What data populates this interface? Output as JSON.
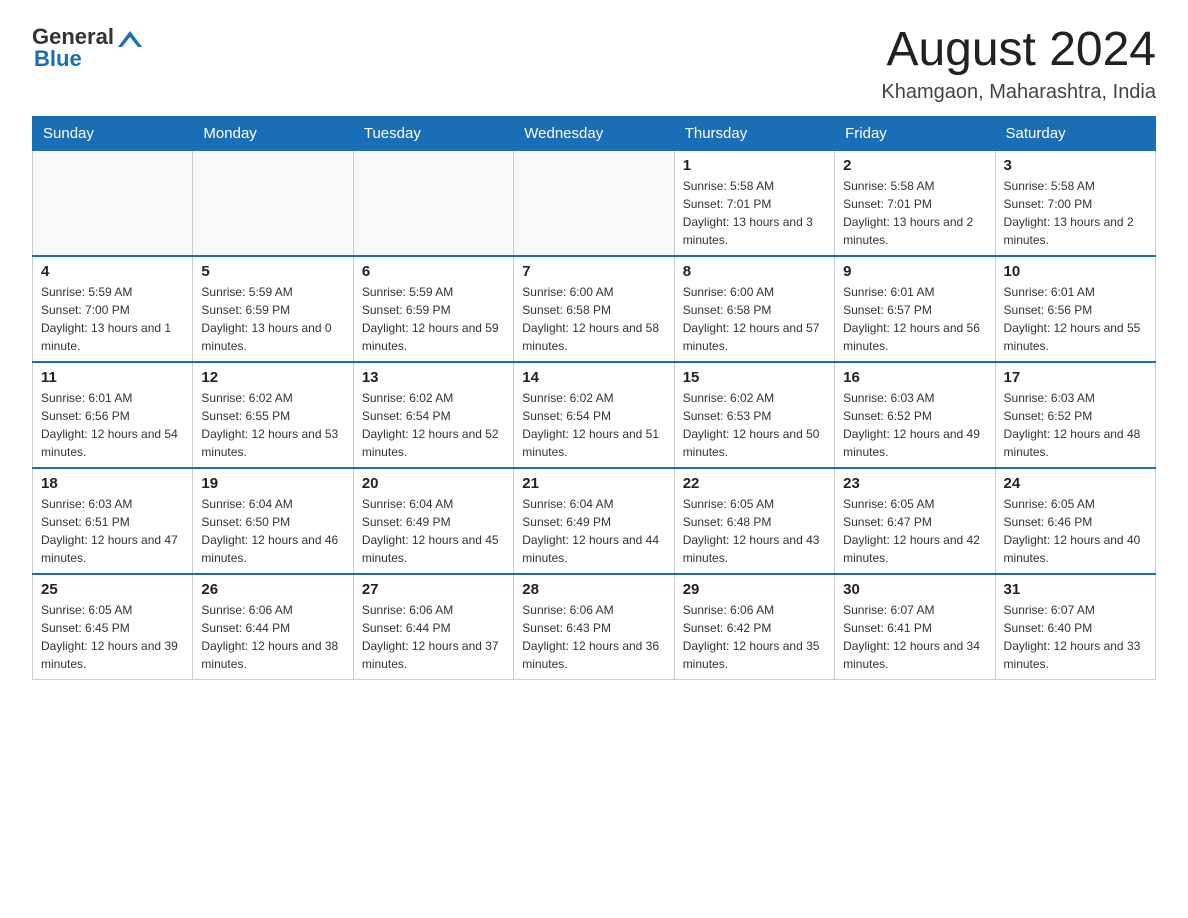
{
  "header": {
    "logo_general": "General",
    "logo_blue": "Blue",
    "month_title": "August 2024",
    "location": "Khamgaon, Maharashtra, India"
  },
  "weekdays": [
    "Sunday",
    "Monday",
    "Tuesday",
    "Wednesday",
    "Thursday",
    "Friday",
    "Saturday"
  ],
  "weeks": [
    [
      {
        "day": "",
        "sunrise": "",
        "sunset": "",
        "daylight": ""
      },
      {
        "day": "",
        "sunrise": "",
        "sunset": "",
        "daylight": ""
      },
      {
        "day": "",
        "sunrise": "",
        "sunset": "",
        "daylight": ""
      },
      {
        "day": "",
        "sunrise": "",
        "sunset": "",
        "daylight": ""
      },
      {
        "day": "1",
        "sunrise": "5:58 AM",
        "sunset": "7:01 PM",
        "daylight": "13 hours and 3 minutes."
      },
      {
        "day": "2",
        "sunrise": "5:58 AM",
        "sunset": "7:01 PM",
        "daylight": "13 hours and 2 minutes."
      },
      {
        "day": "3",
        "sunrise": "5:58 AM",
        "sunset": "7:00 PM",
        "daylight": "13 hours and 2 minutes."
      }
    ],
    [
      {
        "day": "4",
        "sunrise": "5:59 AM",
        "sunset": "7:00 PM",
        "daylight": "13 hours and 1 minute."
      },
      {
        "day": "5",
        "sunrise": "5:59 AM",
        "sunset": "6:59 PM",
        "daylight": "13 hours and 0 minutes."
      },
      {
        "day": "6",
        "sunrise": "5:59 AM",
        "sunset": "6:59 PM",
        "daylight": "12 hours and 59 minutes."
      },
      {
        "day": "7",
        "sunrise": "6:00 AM",
        "sunset": "6:58 PM",
        "daylight": "12 hours and 58 minutes."
      },
      {
        "day": "8",
        "sunrise": "6:00 AM",
        "sunset": "6:58 PM",
        "daylight": "12 hours and 57 minutes."
      },
      {
        "day": "9",
        "sunrise": "6:01 AM",
        "sunset": "6:57 PM",
        "daylight": "12 hours and 56 minutes."
      },
      {
        "day": "10",
        "sunrise": "6:01 AM",
        "sunset": "6:56 PM",
        "daylight": "12 hours and 55 minutes."
      }
    ],
    [
      {
        "day": "11",
        "sunrise": "6:01 AM",
        "sunset": "6:56 PM",
        "daylight": "12 hours and 54 minutes."
      },
      {
        "day": "12",
        "sunrise": "6:02 AM",
        "sunset": "6:55 PM",
        "daylight": "12 hours and 53 minutes."
      },
      {
        "day": "13",
        "sunrise": "6:02 AM",
        "sunset": "6:54 PM",
        "daylight": "12 hours and 52 minutes."
      },
      {
        "day": "14",
        "sunrise": "6:02 AM",
        "sunset": "6:54 PM",
        "daylight": "12 hours and 51 minutes."
      },
      {
        "day": "15",
        "sunrise": "6:02 AM",
        "sunset": "6:53 PM",
        "daylight": "12 hours and 50 minutes."
      },
      {
        "day": "16",
        "sunrise": "6:03 AM",
        "sunset": "6:52 PM",
        "daylight": "12 hours and 49 minutes."
      },
      {
        "day": "17",
        "sunrise": "6:03 AM",
        "sunset": "6:52 PM",
        "daylight": "12 hours and 48 minutes."
      }
    ],
    [
      {
        "day": "18",
        "sunrise": "6:03 AM",
        "sunset": "6:51 PM",
        "daylight": "12 hours and 47 minutes."
      },
      {
        "day": "19",
        "sunrise": "6:04 AM",
        "sunset": "6:50 PM",
        "daylight": "12 hours and 46 minutes."
      },
      {
        "day": "20",
        "sunrise": "6:04 AM",
        "sunset": "6:49 PM",
        "daylight": "12 hours and 45 minutes."
      },
      {
        "day": "21",
        "sunrise": "6:04 AM",
        "sunset": "6:49 PM",
        "daylight": "12 hours and 44 minutes."
      },
      {
        "day": "22",
        "sunrise": "6:05 AM",
        "sunset": "6:48 PM",
        "daylight": "12 hours and 43 minutes."
      },
      {
        "day": "23",
        "sunrise": "6:05 AM",
        "sunset": "6:47 PM",
        "daylight": "12 hours and 42 minutes."
      },
      {
        "day": "24",
        "sunrise": "6:05 AM",
        "sunset": "6:46 PM",
        "daylight": "12 hours and 40 minutes."
      }
    ],
    [
      {
        "day": "25",
        "sunrise": "6:05 AM",
        "sunset": "6:45 PM",
        "daylight": "12 hours and 39 minutes."
      },
      {
        "day": "26",
        "sunrise": "6:06 AM",
        "sunset": "6:44 PM",
        "daylight": "12 hours and 38 minutes."
      },
      {
        "day": "27",
        "sunrise": "6:06 AM",
        "sunset": "6:44 PM",
        "daylight": "12 hours and 37 minutes."
      },
      {
        "day": "28",
        "sunrise": "6:06 AM",
        "sunset": "6:43 PM",
        "daylight": "12 hours and 36 minutes."
      },
      {
        "day": "29",
        "sunrise": "6:06 AM",
        "sunset": "6:42 PM",
        "daylight": "12 hours and 35 minutes."
      },
      {
        "day": "30",
        "sunrise": "6:07 AM",
        "sunset": "6:41 PM",
        "daylight": "12 hours and 34 minutes."
      },
      {
        "day": "31",
        "sunrise": "6:07 AM",
        "sunset": "6:40 PM",
        "daylight": "12 hours and 33 minutes."
      }
    ]
  ]
}
